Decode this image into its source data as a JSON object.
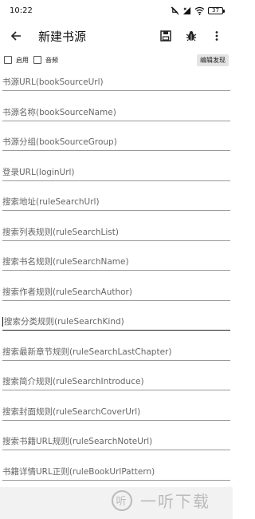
{
  "status_bar": {
    "time": "10:22",
    "battery": "37"
  },
  "toolbar": {
    "title": "新建书源"
  },
  "options": {
    "enable_label": "启用",
    "audio_label": "音频",
    "edit_discover_label": "编辑发现"
  },
  "fields": [
    {
      "hint": "书源URL(bookSourceUrl)"
    },
    {
      "hint": "书源名称(bookSourceName)"
    },
    {
      "hint": "书源分组(bookSourceGroup)"
    },
    {
      "hint": "登录URL(loginUrl)"
    },
    {
      "hint": "搜索地址(ruleSearchUrl)"
    },
    {
      "hint": "搜索列表规则(ruleSearchList)"
    },
    {
      "hint": "搜索书名规则(ruleSearchName)"
    },
    {
      "hint": "搜索作者规则(ruleSearchAuthor)"
    },
    {
      "hint": "搜索分类规则(ruleSearchKind)"
    },
    {
      "hint": "搜索最新章节规则(ruleSearchLastChapter)"
    },
    {
      "hint": "搜索简介规则(ruleSearchIntroduce)"
    },
    {
      "hint": "搜索封面规则(ruleSearchCoverUrl)"
    },
    {
      "hint": "搜索书籍URL规则(ruleSearchNoteUrl)"
    },
    {
      "hint": "书籍详情URL正则(ruleBookUrlPattern)"
    }
  ],
  "watermark": {
    "logo": "听",
    "text": "一听下载"
  }
}
